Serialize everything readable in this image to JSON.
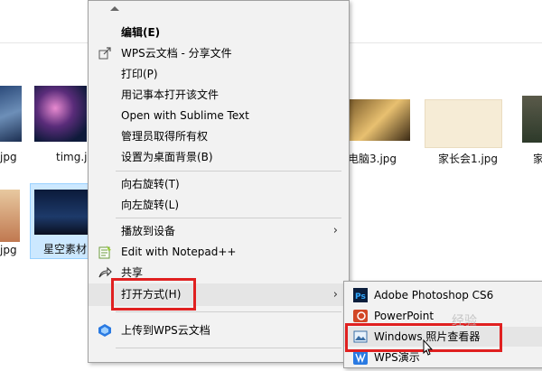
{
  "files": [
    {
      "name": "jpg"
    },
    {
      "name": "timg.jpg"
    },
    {
      "name": "电脑3.jpg"
    },
    {
      "name": "家长会1.jpg"
    },
    {
      "name": "家"
    },
    {
      "name": "jpg"
    },
    {
      "name": "星空素材"
    }
  ],
  "context_menu": {
    "items": [
      {
        "label": "编辑(E)"
      },
      {
        "label": "WPS云文档 - 分享文件"
      },
      {
        "label": "打印(P)"
      },
      {
        "label": "用记事本打开该文件"
      },
      {
        "label": "Open with Sublime Text"
      },
      {
        "label": "管理员取得所有权"
      },
      {
        "label": "设置为桌面背景(B)"
      },
      {
        "label": "向右旋转(T)"
      },
      {
        "label": "向左旋转(L)"
      },
      {
        "label": "播放到设备"
      },
      {
        "label": "Edit with Notepad++"
      },
      {
        "label": "共享"
      },
      {
        "label": "打开方式(H)"
      },
      {
        "label": "上传到WPS云文档"
      }
    ],
    "arrow_glyph": "›"
  },
  "submenu": {
    "items": [
      {
        "label": "Adobe Photoshop CS6"
      },
      {
        "label": "PowerPoint"
      },
      {
        "label": "Windows 照片查看器"
      },
      {
        "label": "WPS演示"
      }
    ]
  },
  "colors": {
    "highlight_red": "#e02020",
    "selection_blue": "#cce8ff",
    "menu_bg": "#f2f2f2"
  },
  "watermark": "经验"
}
